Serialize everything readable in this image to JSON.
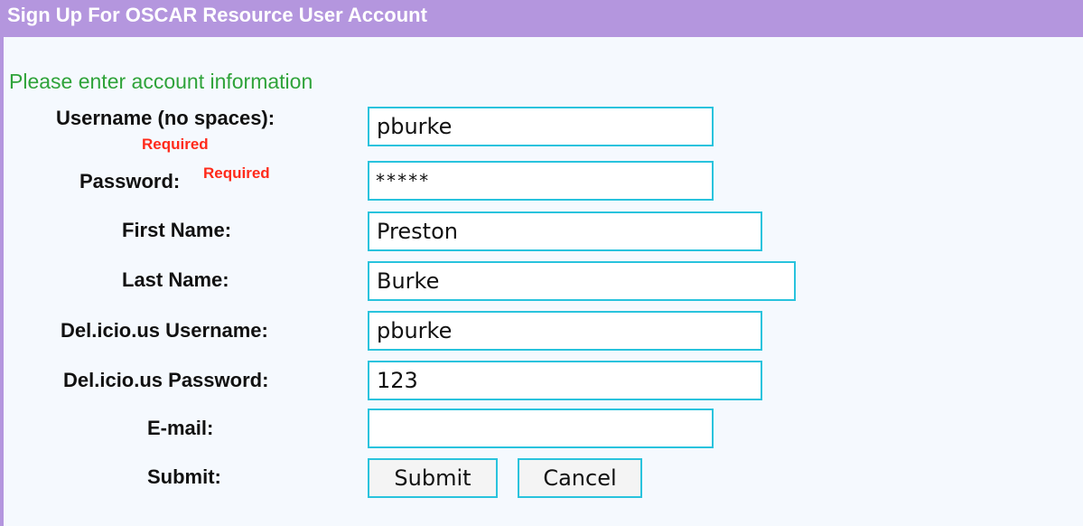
{
  "header": {
    "title": "Sign Up For OSCAR Resource User Account"
  },
  "intro_text": "Please enter account information",
  "required_marker": "Required",
  "fields": {
    "username": {
      "label": "Username (no spaces):",
      "value": "pburke"
    },
    "password": {
      "label": "Password:",
      "value": "*****"
    },
    "first_name": {
      "label": "First Name:",
      "value": "Preston"
    },
    "last_name": {
      "label": "Last Name:",
      "value": "Burke"
    },
    "delicious_username": {
      "label": "Del.icio.us Username:",
      "value": "pburke"
    },
    "delicious_password": {
      "label": "Del.icio.us Password:",
      "value": "123"
    },
    "email": {
      "label": "E-mail:",
      "value": ""
    }
  },
  "actions": {
    "label": "Submit:",
    "submit_label": "Submit",
    "cancel_label": "Cancel"
  },
  "colors": {
    "title_bar": "#b496de",
    "intro_text": "#2fa33a",
    "required_text": "#ff2a1a",
    "input_border": "#29c3dd",
    "panel_background": "#f5f9fe"
  }
}
